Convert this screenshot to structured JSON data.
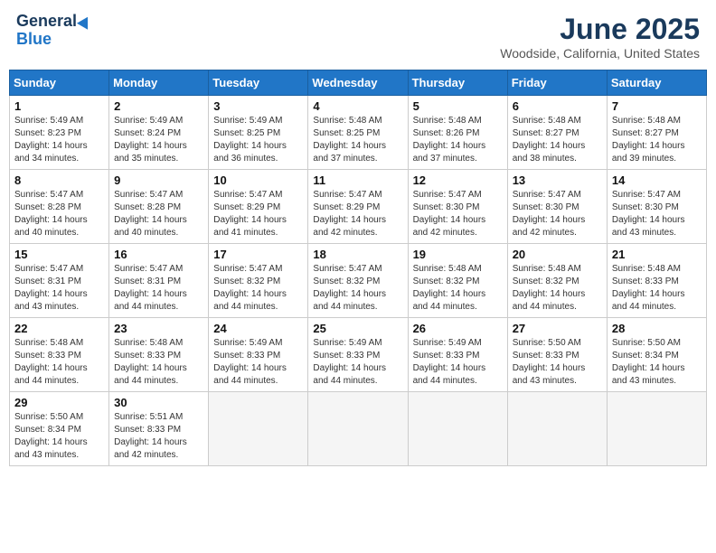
{
  "header": {
    "logo_line1": "General",
    "logo_line2": "Blue",
    "month_year": "June 2025",
    "location": "Woodside, California, United States"
  },
  "weekdays": [
    "Sunday",
    "Monday",
    "Tuesday",
    "Wednesday",
    "Thursday",
    "Friday",
    "Saturday"
  ],
  "weeks": [
    [
      {
        "day": "1",
        "sunrise": "5:49 AM",
        "sunset": "8:23 PM",
        "daylight": "14 hours and 34 minutes."
      },
      {
        "day": "2",
        "sunrise": "5:49 AM",
        "sunset": "8:24 PM",
        "daylight": "14 hours and 35 minutes."
      },
      {
        "day": "3",
        "sunrise": "5:49 AM",
        "sunset": "8:25 PM",
        "daylight": "14 hours and 36 minutes."
      },
      {
        "day": "4",
        "sunrise": "5:48 AM",
        "sunset": "8:25 PM",
        "daylight": "14 hours and 37 minutes."
      },
      {
        "day": "5",
        "sunrise": "5:48 AM",
        "sunset": "8:26 PM",
        "daylight": "14 hours and 37 minutes."
      },
      {
        "day": "6",
        "sunrise": "5:48 AM",
        "sunset": "8:27 PM",
        "daylight": "14 hours and 38 minutes."
      },
      {
        "day": "7",
        "sunrise": "5:48 AM",
        "sunset": "8:27 PM",
        "daylight": "14 hours and 39 minutes."
      }
    ],
    [
      {
        "day": "8",
        "sunrise": "5:47 AM",
        "sunset": "8:28 PM",
        "daylight": "14 hours and 40 minutes."
      },
      {
        "day": "9",
        "sunrise": "5:47 AM",
        "sunset": "8:28 PM",
        "daylight": "14 hours and 40 minutes."
      },
      {
        "day": "10",
        "sunrise": "5:47 AM",
        "sunset": "8:29 PM",
        "daylight": "14 hours and 41 minutes."
      },
      {
        "day": "11",
        "sunrise": "5:47 AM",
        "sunset": "8:29 PM",
        "daylight": "14 hours and 42 minutes."
      },
      {
        "day": "12",
        "sunrise": "5:47 AM",
        "sunset": "8:30 PM",
        "daylight": "14 hours and 42 minutes."
      },
      {
        "day": "13",
        "sunrise": "5:47 AM",
        "sunset": "8:30 PM",
        "daylight": "14 hours and 42 minutes."
      },
      {
        "day": "14",
        "sunrise": "5:47 AM",
        "sunset": "8:30 PM",
        "daylight": "14 hours and 43 minutes."
      }
    ],
    [
      {
        "day": "15",
        "sunrise": "5:47 AM",
        "sunset": "8:31 PM",
        "daylight": "14 hours and 43 minutes."
      },
      {
        "day": "16",
        "sunrise": "5:47 AM",
        "sunset": "8:31 PM",
        "daylight": "14 hours and 44 minutes."
      },
      {
        "day": "17",
        "sunrise": "5:47 AM",
        "sunset": "8:32 PM",
        "daylight": "14 hours and 44 minutes."
      },
      {
        "day": "18",
        "sunrise": "5:47 AM",
        "sunset": "8:32 PM",
        "daylight": "14 hours and 44 minutes."
      },
      {
        "day": "19",
        "sunrise": "5:48 AM",
        "sunset": "8:32 PM",
        "daylight": "14 hours and 44 minutes."
      },
      {
        "day": "20",
        "sunrise": "5:48 AM",
        "sunset": "8:32 PM",
        "daylight": "14 hours and 44 minutes."
      },
      {
        "day": "21",
        "sunrise": "5:48 AM",
        "sunset": "8:33 PM",
        "daylight": "14 hours and 44 minutes."
      }
    ],
    [
      {
        "day": "22",
        "sunrise": "5:48 AM",
        "sunset": "8:33 PM",
        "daylight": "14 hours and 44 minutes."
      },
      {
        "day": "23",
        "sunrise": "5:48 AM",
        "sunset": "8:33 PM",
        "daylight": "14 hours and 44 minutes."
      },
      {
        "day": "24",
        "sunrise": "5:49 AM",
        "sunset": "8:33 PM",
        "daylight": "14 hours and 44 minutes."
      },
      {
        "day": "25",
        "sunrise": "5:49 AM",
        "sunset": "8:33 PM",
        "daylight": "14 hours and 44 minutes."
      },
      {
        "day": "26",
        "sunrise": "5:49 AM",
        "sunset": "8:33 PM",
        "daylight": "14 hours and 44 minutes."
      },
      {
        "day": "27",
        "sunrise": "5:50 AM",
        "sunset": "8:33 PM",
        "daylight": "14 hours and 43 minutes."
      },
      {
        "day": "28",
        "sunrise": "5:50 AM",
        "sunset": "8:34 PM",
        "daylight": "14 hours and 43 minutes."
      }
    ],
    [
      {
        "day": "29",
        "sunrise": "5:50 AM",
        "sunset": "8:34 PM",
        "daylight": "14 hours and 43 minutes."
      },
      {
        "day": "30",
        "sunrise": "5:51 AM",
        "sunset": "8:33 PM",
        "daylight": "14 hours and 42 minutes."
      },
      {
        "day": "",
        "sunrise": "",
        "sunset": "",
        "daylight": ""
      },
      {
        "day": "",
        "sunrise": "",
        "sunset": "",
        "daylight": ""
      },
      {
        "day": "",
        "sunrise": "",
        "sunset": "",
        "daylight": ""
      },
      {
        "day": "",
        "sunrise": "",
        "sunset": "",
        "daylight": ""
      },
      {
        "day": "",
        "sunrise": "",
        "sunset": "",
        "daylight": ""
      }
    ]
  ]
}
